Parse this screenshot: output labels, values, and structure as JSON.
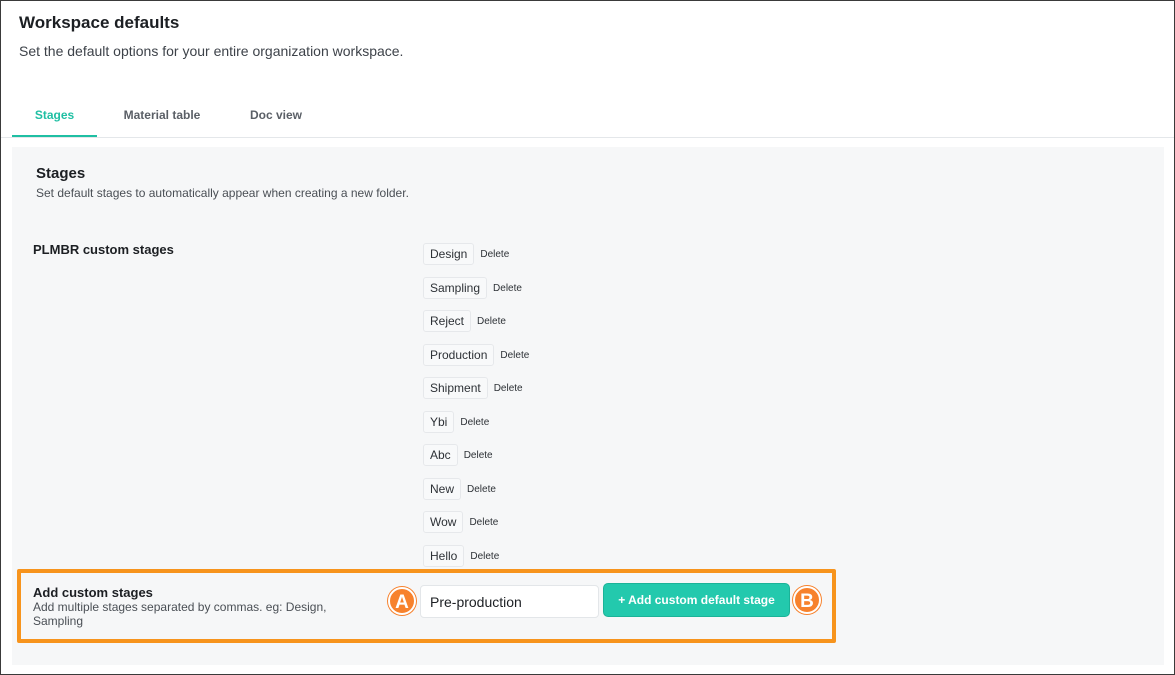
{
  "header": {
    "title": "Workspace defaults",
    "subtitle": "Set the default options for your entire organization workspace."
  },
  "tabs": [
    {
      "label": "Stages",
      "active": true
    },
    {
      "label": "Material table",
      "active": false
    },
    {
      "label": "Doc view",
      "active": false
    }
  ],
  "stages_section": {
    "title": "Stages",
    "description": "Set default stages to automatically appear when creating a new folder.",
    "custom_label": "PLMBR custom stages",
    "delete_label": "Delete",
    "items": [
      "Design",
      "Sampling",
      "Reject",
      "Production",
      "Shipment",
      "Ybi",
      "Abc",
      "New",
      "Wow",
      "Hello"
    ]
  },
  "add_custom": {
    "title": "Add custom stages",
    "description": "Add multiple stages separated by commas. eg: Design, Sampling",
    "input_value": "Pre-production",
    "button_label": "+ Add custom default stage"
  },
  "markers": {
    "a": "A",
    "b": "B"
  },
  "colors": {
    "accent": "#1fbfa3",
    "button": "#23c9ad",
    "highlight": "#f7941d",
    "marker": "#f7822d"
  }
}
